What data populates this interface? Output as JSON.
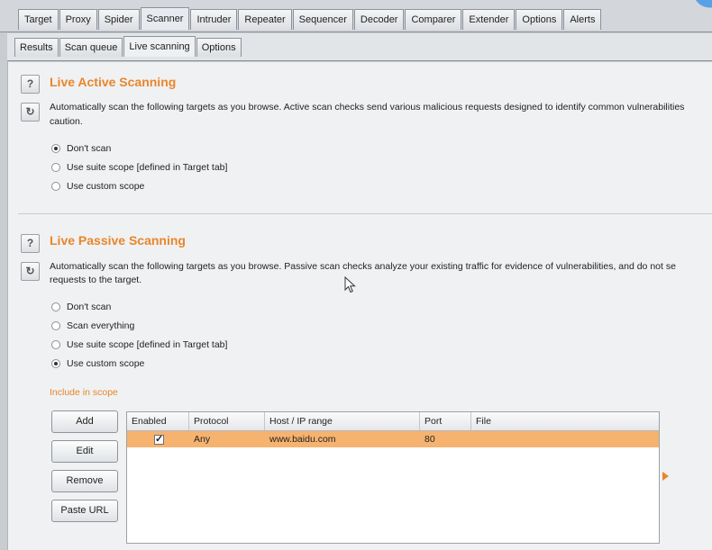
{
  "tabs": [
    "Target",
    "Proxy",
    "Spider",
    "Scanner",
    "Intruder",
    "Repeater",
    "Sequencer",
    "Decoder",
    "Comparer",
    "Extender",
    "Options",
    "Alerts"
  ],
  "active_tab": "Scanner",
  "subtabs": [
    "Results",
    "Scan queue",
    "Live scanning",
    "Options"
  ],
  "active_subtab": "Live scanning",
  "active_scanning": {
    "title": "Live Active Scanning",
    "desc_line1": "Automatically scan the following targets as you browse. Active scan checks send various malicious requests designed to identify common vulnerabilities",
    "desc_line2": "caution.",
    "options": [
      "Don't scan",
      "Use suite scope [defined in Target tab]",
      "Use custom scope"
    ],
    "selected": 0
  },
  "passive_scanning": {
    "title": "Live Passive Scanning",
    "desc_line1": "Automatically scan the following targets as you browse. Passive scan checks analyze your existing traffic for evidence of vulnerabilities, and do not se",
    "desc_line2": "requests to the target.",
    "options": [
      "Don't scan",
      "Scan everything",
      "Use suite scope [defined in Target tab]",
      "Use custom scope"
    ],
    "selected": 3
  },
  "scope": {
    "label": "Include in scope",
    "buttons": [
      "Add",
      "Edit",
      "Remove",
      "Paste URL"
    ],
    "columns": [
      "Enabled",
      "Protocol",
      "Host / IP range",
      "Port",
      "File"
    ],
    "rows": [
      {
        "enabled": true,
        "protocol": "Any",
        "host": "www.baidu.com",
        "port": "80",
        "file": ""
      }
    ]
  },
  "icons": [
    "help-icon",
    "refresh-icon",
    "mouse-cursor-icon",
    "expand-arrow-icon"
  ]
}
